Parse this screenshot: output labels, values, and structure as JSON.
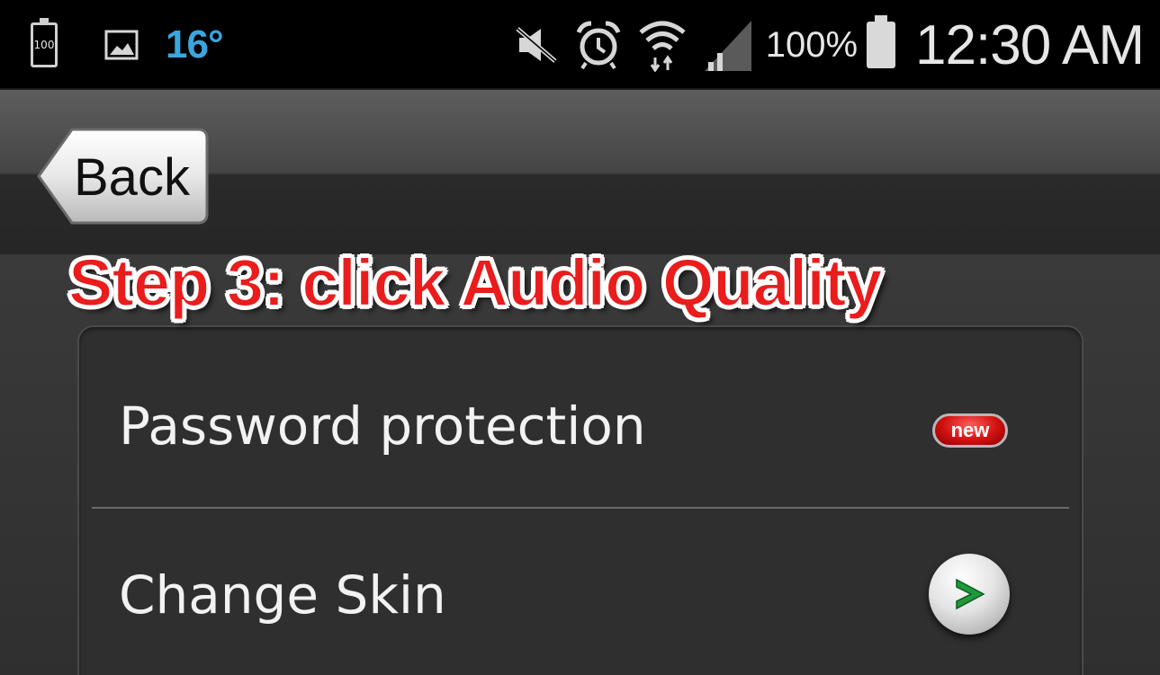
{
  "status_bar": {
    "battery_small_label": "100",
    "temperature": "16°",
    "battery_percent": "100%",
    "time": "12:30 AM",
    "icons": [
      "battery-icon",
      "gallery-icon",
      "mute-icon",
      "alarm-icon",
      "wifi-icon",
      "signal-icon",
      "battery-icon"
    ]
  },
  "header": {
    "back_label": "Back"
  },
  "overlay": {
    "step_text": "Step 3: click Audio Quality"
  },
  "settings": {
    "items": [
      {
        "label": "Password protection",
        "badge": "new",
        "accessory": "new-badge"
      },
      {
        "label": "Change Skin",
        "accessory": "chevron-right-icon"
      }
    ]
  },
  "colors": {
    "temperature": "#3aa6df",
    "overlay_text": "#ea1c1c",
    "badge": "#d01010",
    "chevron": "#1f9a3a"
  }
}
